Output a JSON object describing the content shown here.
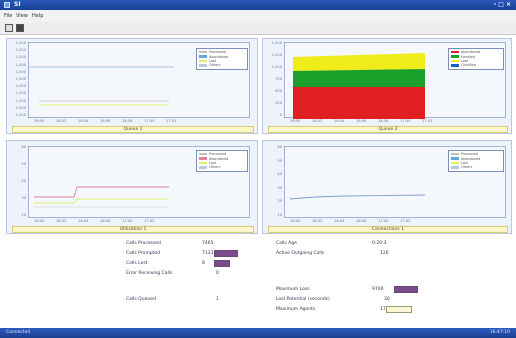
{
  "window": {
    "title": "SI",
    "controls": "- □ ×"
  },
  "menu": [
    "File",
    "View",
    "Help"
  ],
  "charts": [
    {
      "id": "c1",
      "y_ticks": [
        "1,000",
        "1,000",
        "1,000",
        "1,000",
        "1,000",
        "1,000",
        "1,000",
        "1,000",
        "1,000",
        "1,000",
        "1,000"
      ],
      "x_ticks": [
        "16:00",
        "16:02",
        "16:04",
        "16:06",
        "16:08",
        "17:00",
        "17:02"
      ],
      "legend": [
        {
          "label": "Processed",
          "color": "#bfbfbf"
        },
        {
          "label": "Abandoned",
          "color": "#5aa9d6"
        },
        {
          "label": "Lost",
          "color": "#e4ef69"
        },
        {
          "label": "Others",
          "color": "#b7c6e2"
        }
      ],
      "caption": "Queue 1"
    },
    {
      "id": "c2",
      "y_ticks": [
        "1,500",
        "1,250",
        "1,000",
        "750",
        "500",
        "250",
        "0"
      ],
      "x_ticks": [
        "16:00",
        "16:02",
        "16:04",
        "16:06",
        "16:08",
        "17:00",
        "17:02"
      ],
      "legend": [
        {
          "label": "Abandoned",
          "color": "#e02020"
        },
        {
          "label": "Handled",
          "color": "#1aa02a"
        },
        {
          "label": "Lost",
          "color": "#f0ec1a"
        },
        {
          "label": "Overflow",
          "color": "#1a5fc0"
        }
      ],
      "caption": "Queue 2"
    },
    {
      "id": "c3",
      "y_ticks": [
        "60",
        "50",
        "40",
        "30",
        "20"
      ],
      "x_ticks": [
        "16:00",
        "16:02",
        "16:04",
        "16:06",
        "17:00",
        "17:02"
      ],
      "legend": [
        {
          "label": "Processed",
          "color": "#bfbfbf"
        },
        {
          "label": "Abandoned",
          "color": "#e07f9a"
        },
        {
          "label": "Lost",
          "color": "#e4ef69"
        },
        {
          "label": "Others",
          "color": "#b7c6e2"
        }
      ],
      "caption": "Utilization 1"
    },
    {
      "id": "c4",
      "y_ticks": [
        "60",
        "50",
        "40",
        "30",
        "20",
        "10"
      ],
      "x_ticks": [
        "16:00",
        "16:02",
        "16:04",
        "16:06",
        "17:00",
        "17:02"
      ],
      "legend": [
        {
          "label": "Processed",
          "color": "#bfbfbf"
        },
        {
          "label": "Abandoned",
          "color": "#5aa9d6"
        },
        {
          "label": "Lost",
          "color": "#e4ef69"
        },
        {
          "label": "Others",
          "color": "#b7c6e2"
        }
      ],
      "caption": "Connections 1"
    }
  ],
  "stats_left": [
    {
      "label": "Calls Processed",
      "value": "7465"
    },
    {
      "label": "Calls Prompted",
      "value": "7123"
    },
    {
      "label": "Calls Lost",
      "value": "8"
    },
    {
      "label": "Error Receiving Calls",
      "value": "0"
    },
    {
      "label": "Calls Queued",
      "value": "1"
    }
  ],
  "stats_right": [
    {
      "label": "Calls Age",
      "value": "0:20:3"
    },
    {
      "label": "Active Outgoing Calls",
      "value": "126"
    },
    {
      "label": "Maximum Loss",
      "value": "9700"
    },
    {
      "label": "Lost Potential (seconds)",
      "value": "30"
    },
    {
      "label": "Maximum Agents",
      "value": "17"
    }
  ],
  "status": {
    "left": "Connected",
    "right": "16:47:10"
  }
}
